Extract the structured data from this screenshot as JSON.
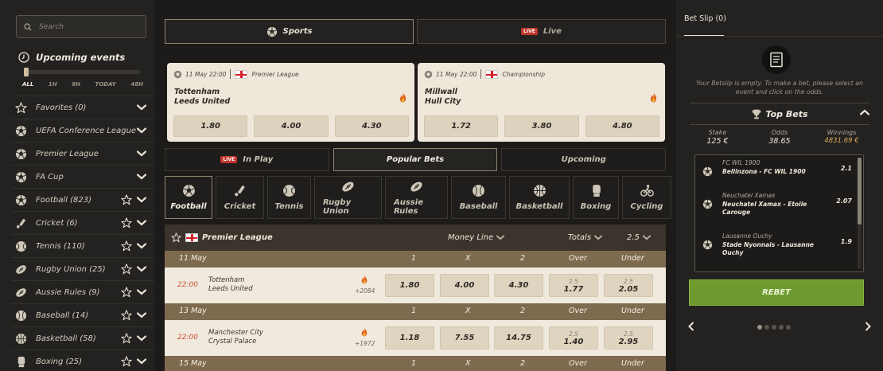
{
  "search": {
    "placeholder": "Search"
  },
  "upcoming": {
    "title": "Upcoming events",
    "time_filters": [
      "ALL",
      "1H",
      "8H",
      "TODAY",
      "48H"
    ]
  },
  "sidebar": {
    "items": [
      {
        "label": "Favorites (0)",
        "icon": "star-icon"
      },
      {
        "label": "UEFA Conference League",
        "icon": "soccer-ball-icon"
      },
      {
        "label": "Premier League",
        "icon": "soccer-ball-icon"
      },
      {
        "label": "FA Cup",
        "icon": "soccer-ball-icon"
      },
      {
        "label": "Football (823)",
        "icon": "soccer-ball-icon"
      },
      {
        "label": "Cricket (6)",
        "icon": "cricket-bat-icon"
      },
      {
        "label": "Tennis (110)",
        "icon": "tennis-ball-icon"
      },
      {
        "label": "Rugby Union (25)",
        "icon": "rugby-ball-icon"
      },
      {
        "label": "Aussie Rules (9)",
        "icon": "aussie-rules-ball-icon"
      },
      {
        "label": "Baseball (14)",
        "icon": "baseball-icon"
      },
      {
        "label": "Basketball (58)",
        "icon": "basketball-icon"
      },
      {
        "label": "Boxing (25)",
        "icon": "boxing-glove-icon"
      }
    ]
  },
  "top_tabs": {
    "sports": "Sports",
    "live": "Live",
    "live_badge": "LIVE"
  },
  "cards": [
    {
      "time": "11 May 22:00",
      "league": "Premier League",
      "home": "Tottenham",
      "away": "Leeds United",
      "odds": [
        "1.80",
        "4.00",
        "4.30"
      ]
    },
    {
      "time": "11 May 22:00",
      "league": "Championship",
      "home": "Millwall",
      "away": "Hull City",
      "odds": [
        "1.72",
        "3.80",
        "4.80"
      ]
    }
  ],
  "mid_tabs": {
    "in_play": "In Play",
    "live_badge": "LIVE",
    "popular": "Popular Bets",
    "upcoming": "Upcoming"
  },
  "sport_tabs": [
    "Football",
    "Cricket",
    "Tennis",
    "Rugby Union",
    "Aussie Rules",
    "Baseball",
    "Basketball",
    "Boxing",
    "Cycling"
  ],
  "table": {
    "league": "Premier League",
    "money_line": "Money Line",
    "totals": "Totals",
    "line": "2.5",
    "col_headers": [
      "1",
      "X",
      "2",
      "Over",
      "Under"
    ],
    "days": [
      {
        "date": "11 May",
        "match": {
          "time": "22:00",
          "home": "Tottenham",
          "away": "Leeds United",
          "count": "+2084",
          "odds": [
            "1.80",
            "4.00",
            "4.30"
          ],
          "over_line": "2.5",
          "over": "1.77",
          "under_line": "2.5",
          "under": "2.05"
        }
      },
      {
        "date": "13 May",
        "match": {
          "time": "22:00",
          "home": "Manchester City",
          "away": "Crystal Palace",
          "count": "+1972",
          "odds": [
            "1.18",
            "7.55",
            "14.75"
          ],
          "over_line": "2.5",
          "over": "1.40",
          "under_line": "2.5",
          "under": "2.95"
        }
      },
      {
        "date": "15 May"
      }
    ]
  },
  "betslip": {
    "tab": "Bet Slip (0)",
    "empty_text": "Your Betslip is empty. To make a bet, please select an event and click on the odds.",
    "top_bets_title": "Top Bets",
    "stake_label": "Stake",
    "stake": "125 €",
    "odds_label": "Odds",
    "odds": "38.65",
    "winnings_label": "Winnings",
    "winnings": "4831.69 €",
    "items": [
      {
        "league": "FC WIL 1900",
        "match": "Bellinzona - FC WIL 1900",
        "odd": "2.1"
      },
      {
        "league": "Neuchatel Xamax",
        "match": "Neuchatel Xamax - Etoile Carouge",
        "odd": "2.07"
      },
      {
        "league": "Lausanne Ouchy",
        "match": "Stade Nyonnais - Lausanne Ouchy",
        "odd": "1.9"
      }
    ],
    "rebet": "REBET"
  },
  "colors": {
    "accent_green": "#6e9b2f",
    "live_red": "#c0362c",
    "card_bg": "#efe7da",
    "day_band": "#7e6a4e",
    "time_red": "#c94a2a"
  }
}
